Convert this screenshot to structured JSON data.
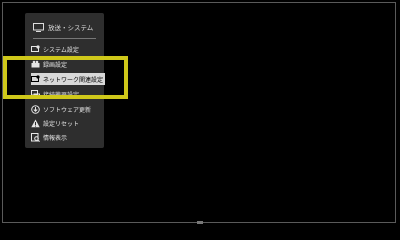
{
  "menu": {
    "title": "放送・システム",
    "items": [
      {
        "label": "システム設定",
        "icon": "system-settings-icon"
      },
      {
        "label": "録画設定",
        "icon": "recording-settings-icon"
      },
      {
        "label": "ネットワーク関連設定",
        "icon": "network-settings-icon",
        "selected": true
      },
      {
        "label": "接続機器設定",
        "icon": "connected-devices-icon"
      },
      {
        "label": "ソフトウェア更新",
        "icon": "software-update-icon"
      },
      {
        "label": "設定リセット",
        "icon": "reset-warning-icon"
      },
      {
        "label": "情報表示",
        "icon": "info-display-icon"
      }
    ]
  },
  "colors": {
    "background": "#000000",
    "panel": "#2e2e2e",
    "selected_item": "#d8d8d8",
    "highlight": "#cfc81a"
  }
}
